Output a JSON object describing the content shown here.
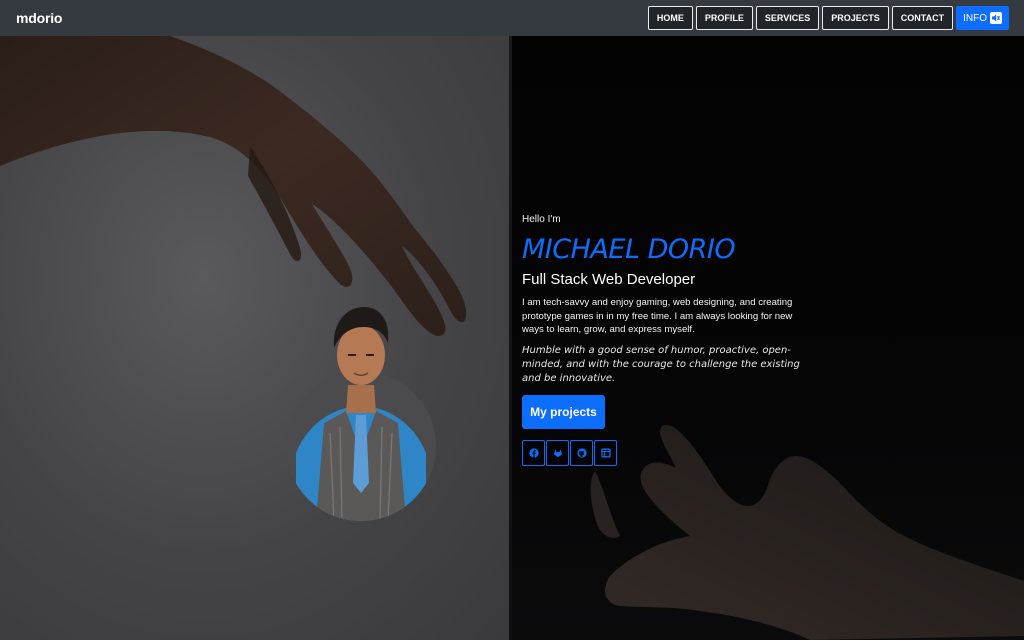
{
  "brand": "mdorio",
  "nav": {
    "home": "HOME",
    "profile": "PROFILE",
    "services": "SERVICES",
    "projects": "PROJECTS",
    "contact": "CONTACT",
    "info": "INFO"
  },
  "hero": {
    "greeting": "Hello I'm",
    "name": "MICHAEL DORIO",
    "role": "Full Stack Web Developer",
    "bio": "I am tech-savvy and enjoy gaming, web designing, and creating prototype games in in my free time. I am always looking for new ways to learn, grow, and express myself.",
    "motto": "Humble with a good sense of humor, proactive, open-minded, and with the courage to challenge the existing and be innovative.",
    "cta": "My projects"
  },
  "socials": [
    "facebook-icon",
    "gitlab-icon",
    "github-icon",
    "window-icon"
  ],
  "colors": {
    "accent": "#0d6efd",
    "navbar": "#343a40",
    "left_panel": "#444446",
    "right_panel": "#050506"
  }
}
